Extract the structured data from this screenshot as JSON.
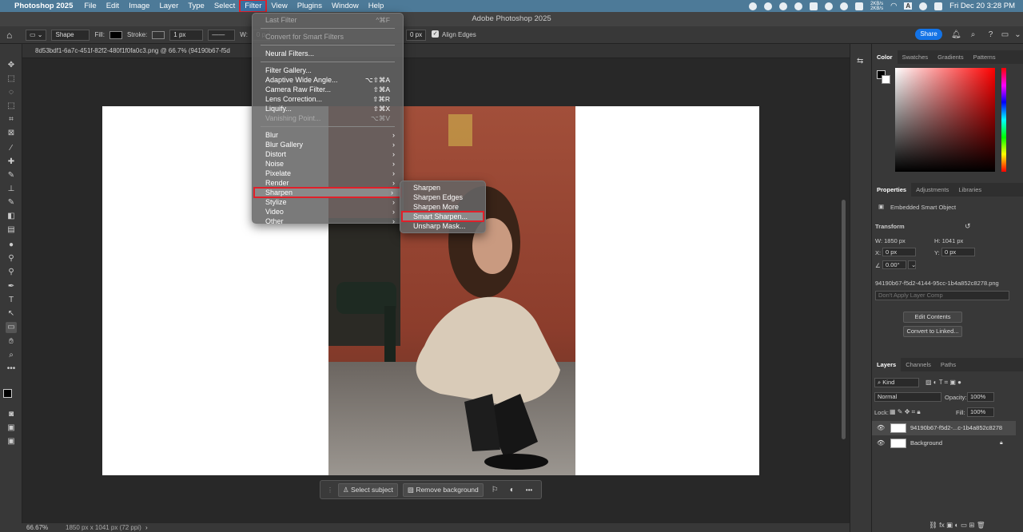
{
  "menubar": {
    "app_name": "Photoshop 2025",
    "items": [
      "File",
      "Edit",
      "Image",
      "Layer",
      "Type",
      "Select",
      "Filter",
      "View",
      "Plugins",
      "Window",
      "Help"
    ],
    "active": "Filter",
    "net_speed_up": "2KB/s",
    "net_speed_down": "2KB/s",
    "input_source": "A",
    "datetime": "Fri Dec 20  3:28 PM"
  },
  "window": {
    "title": "Adobe Photoshop 2025"
  },
  "options_bar": {
    "tool_mode": "Shape",
    "fill_label": "Fill:",
    "stroke_label": "Stroke:",
    "stroke_width": "1 px",
    "w_label": "W:",
    "w_value": "0 p",
    "h_value": "0 px",
    "align_edges": "Align Edges",
    "share_label": "Share"
  },
  "document": {
    "tab_title": "8d53bdf1-6a7c-451f-82f2-480f1f0fa0c3.png @ 66.7% (94190b67-f5d",
    "zoom": "66.67%",
    "size_info": "1850 px x 1041 px (72 ppi)"
  },
  "filter_menu": {
    "group1": [
      {
        "label": "Last Filter",
        "shortcut": "^⌘F",
        "disabled": true
      },
      {
        "label": "Convert for Smart Filters",
        "shortcut": "",
        "disabled": true
      }
    ],
    "group2": [
      {
        "label": "Neural Filters...",
        "shortcut": ""
      }
    ],
    "group3": [
      {
        "label": "Filter Gallery...",
        "shortcut": ""
      },
      {
        "label": "Adaptive Wide Angle...",
        "shortcut": "⌥⇧⌘A"
      },
      {
        "label": "Camera Raw Filter...",
        "shortcut": "⇧⌘A"
      },
      {
        "label": "Lens Correction...",
        "shortcut": "⇧⌘R"
      },
      {
        "label": "Liquify...",
        "shortcut": "⇧⌘X"
      },
      {
        "label": "Vanishing Point...",
        "shortcut": "⌥⌘V",
        "disabled": true
      }
    ],
    "group4": [
      "Blur",
      "Blur Gallery",
      "Distort",
      "Noise",
      "Pixelate",
      "Render",
      "Sharpen",
      "Stylize",
      "Video",
      "Other"
    ],
    "highlighted": "Sharpen"
  },
  "sharpen_submenu": {
    "items": [
      "Sharpen",
      "Sharpen Edges",
      "Sharpen More",
      "Smart Sharpen...",
      "Unsharp Mask..."
    ],
    "highlighted": "Smart Sharpen..."
  },
  "context_bar": {
    "select_subject": "Select subject",
    "remove_background": "Remove background",
    "more": "•••"
  },
  "color_panel": {
    "tabs": [
      "Color",
      "Swatches",
      "Gradients",
      "Patterns"
    ],
    "active_tab": "Color",
    "foreground": "#000000",
    "background": "#ffffff",
    "hue": "#ff0000"
  },
  "properties_panel": {
    "tabs": [
      "Properties",
      "Adjustments",
      "Libraries"
    ],
    "active_tab": "Properties",
    "object_type": "Embedded Smart Object",
    "transform_label": "Transform",
    "w": "W: 1850 px",
    "h": "H: 1041 px",
    "x_label": "X:",
    "x_value": "0 px",
    "y_label": "Y:",
    "y_value": "0 px",
    "angle": "0.00°",
    "filename": "94190b67-f5d2-4144-95cc-1b4a852c8278.png",
    "layer_comp": "Don't Apply Layer Comp",
    "edit_contents": "Edit Contents",
    "convert_linked": "Convert to Linked..."
  },
  "layers_panel": {
    "tabs": [
      "Layers",
      "Channels",
      "Paths"
    ],
    "active_tab": "Layers",
    "filter_kind": "Kind",
    "blend_mode": "Normal",
    "opacity_label": "Opacity:",
    "opacity": "100%",
    "lock_label": "Lock:",
    "fill_label": "Fill:",
    "fill": "100%",
    "layers": [
      {
        "name": "94190b67-f5d2-...c-1b4a852c8278",
        "selected": true
      },
      {
        "name": "Background",
        "selected": false
      }
    ]
  }
}
